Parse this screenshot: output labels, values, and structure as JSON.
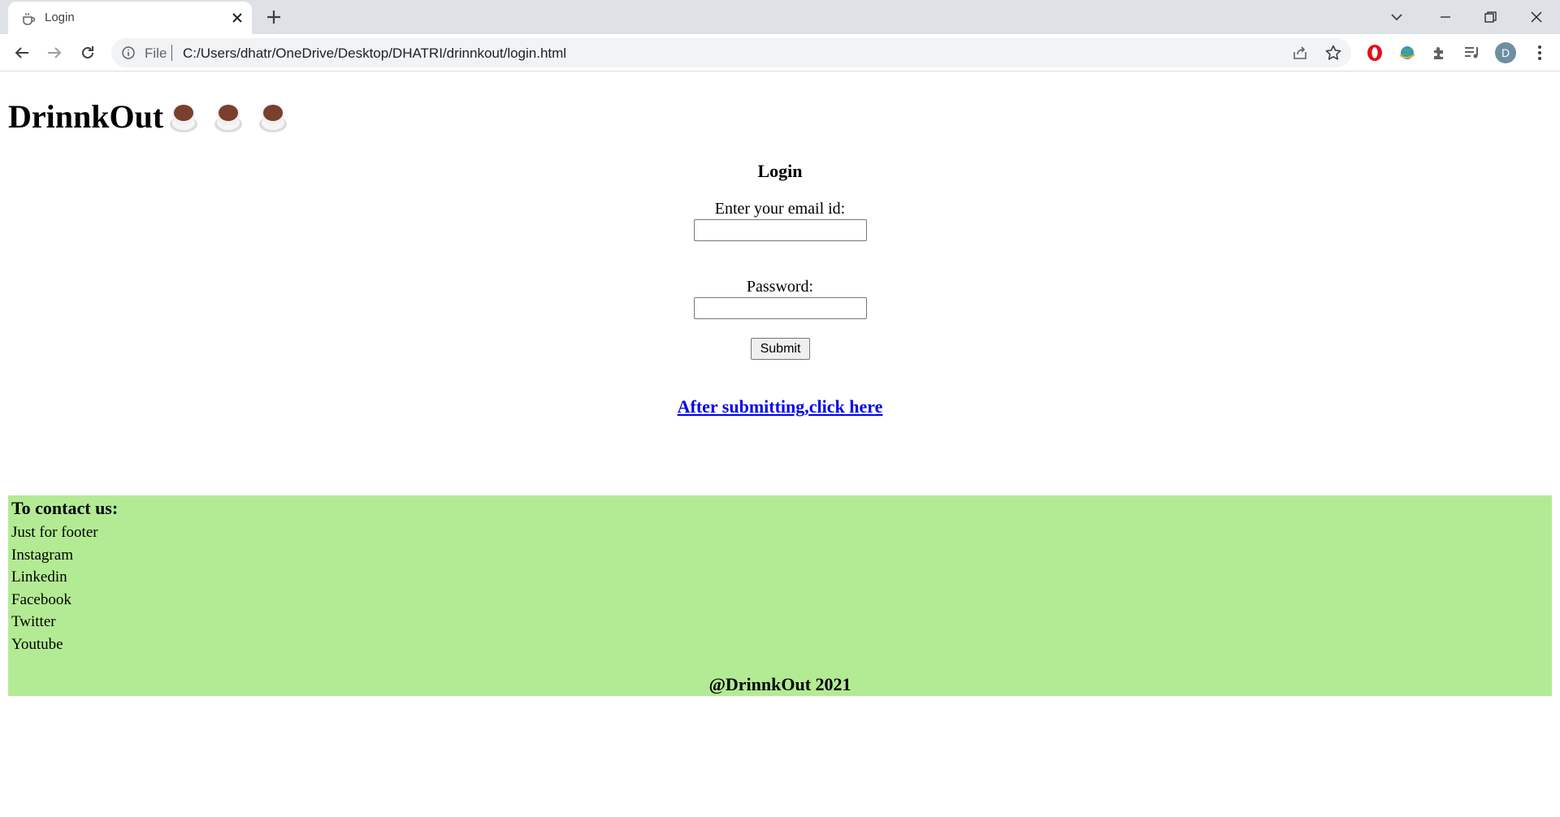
{
  "browser": {
    "tab_title": "Login",
    "omnibox_scheme": "File",
    "omnibox_url": "C:/Users/dhatr/OneDrive/Desktop/DHATRI/drinnkout/login.html",
    "profile_initial": "D"
  },
  "page": {
    "site_title": "DrinnkOut",
    "login_heading": "Login",
    "email_label": "Enter your email id:",
    "email_value": "",
    "password_label": "Password:",
    "password_value": "",
    "submit_label": "Submit",
    "after_link_text": "After submitting,click here"
  },
  "footer": {
    "heading": "To contact us:",
    "items": [
      "Just for footer",
      "Instagram",
      "Linkedin",
      "Facebook",
      "Twitter",
      "Youtube"
    ],
    "copyright": "@DrinnkOut 2021",
    "background_color": "#b3eb94"
  }
}
